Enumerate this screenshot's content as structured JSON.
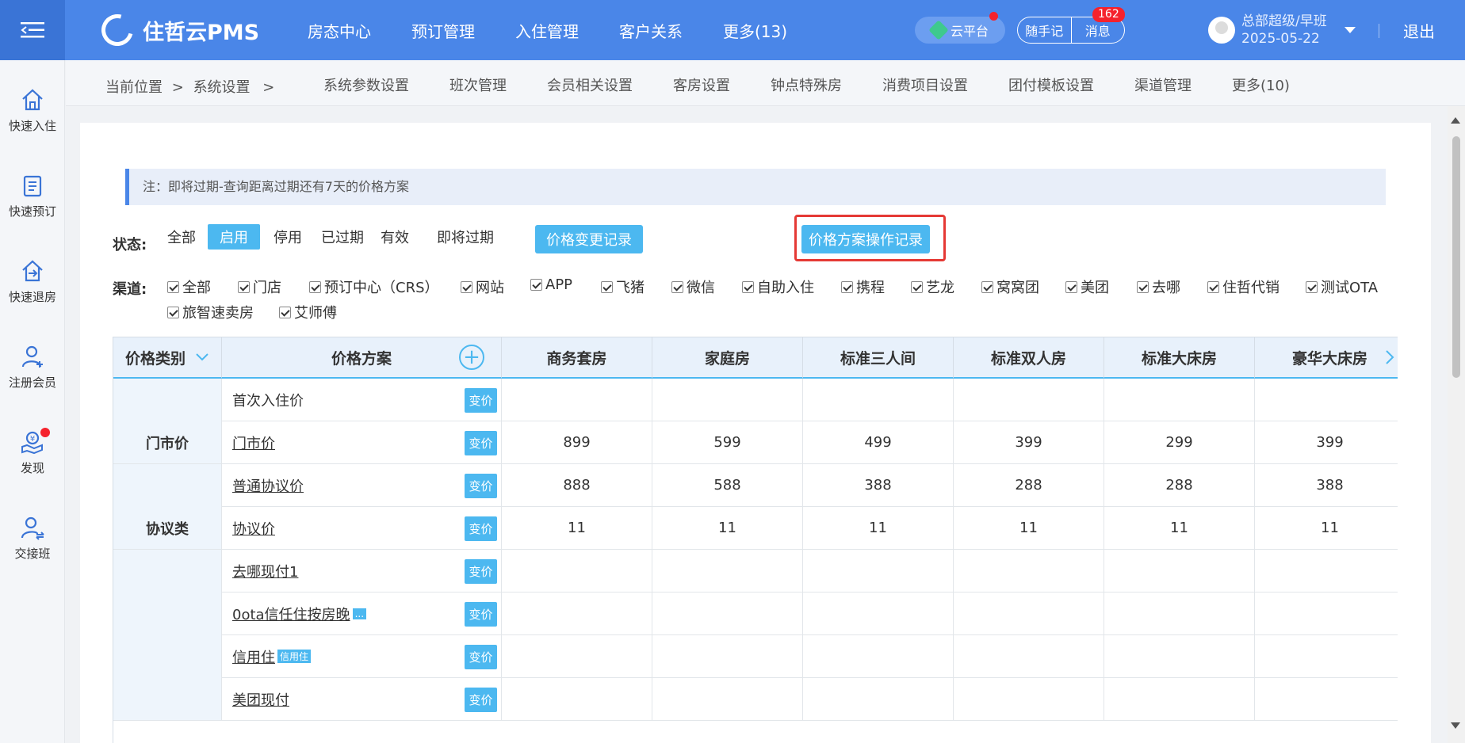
{
  "app": {
    "title": "住哲云PMS"
  },
  "topnav": {
    "items": [
      "房态中心",
      "预订管理",
      "入住管理",
      "客户关系",
      "更多(13)"
    ]
  },
  "header": {
    "cloud_label": "云平台",
    "note_label": "随手记",
    "message_label": "消息",
    "message_count": "162",
    "user_name": "总部超级/早班",
    "user_date": "2025-05-22",
    "logout_label": "退出"
  },
  "sidebar": {
    "items": [
      {
        "label": "快速入住",
        "icon": "home-icon"
      },
      {
        "label": "快速预订",
        "icon": "book-icon"
      },
      {
        "label": "快速退房",
        "icon": "checkout-icon"
      },
      {
        "label": "注册会员",
        "icon": "add-user-icon"
      },
      {
        "label": "发现",
        "icon": "discover-icon"
      },
      {
        "label": "交接班",
        "icon": "handover-icon"
      }
    ]
  },
  "breadcrumb": {
    "current": "当前位置",
    "section": "系统设置",
    "sep": ">"
  },
  "subnav": {
    "items": [
      "系统参数设置",
      "班次管理",
      "会员相关设置",
      "客房设置",
      "钟点特殊房",
      "消费项目设置",
      "团付模板设置",
      "渠道管理",
      "更多(10)"
    ]
  },
  "notice": "注：即将过期-查询距离过期还有7天的价格方案",
  "status_filter": {
    "label": "状态:",
    "options": [
      "全部",
      "启用",
      "停用",
      "已过期",
      "有效",
      "即将过期"
    ],
    "active": "启用",
    "price_change_log": "价格变更记录",
    "plan_operation_log": "价格方案操作记录"
  },
  "channel_filter": {
    "label": "渠道:",
    "options": [
      "全部",
      "门店",
      "预订中心（CRS）",
      "网站",
      "APP",
      "飞猪",
      "微信",
      "自助入住",
      "携程",
      "艺龙",
      "窝窝团",
      "美团",
      "去哪",
      "住哲代销",
      "测试OTA",
      "旅智速卖房",
      "艾师傅"
    ]
  },
  "table": {
    "headers": {
      "category": "价格类别",
      "plan": "价格方案",
      "rooms": [
        "商务套房",
        "家庭房",
        "标准三人间",
        "标准双人房",
        "标准大床房",
        "豪华大床房"
      ]
    },
    "change_label": "变价",
    "categories": [
      "门市价",
      "协议类"
    ],
    "rows": [
      {
        "plan": "首次入住价",
        "underline": false,
        "tag": "",
        "prices": [
          "",
          "",
          "",
          "",
          "",
          ""
        ]
      },
      {
        "plan": "门市价",
        "underline": true,
        "tag": "",
        "prices": [
          "899",
          "599",
          "499",
          "399",
          "299",
          "399"
        ]
      },
      {
        "plan": "普通协议价",
        "underline": true,
        "tag": "",
        "prices": [
          "888",
          "588",
          "388",
          "288",
          "288",
          "388"
        ]
      },
      {
        "plan": "协议价",
        "underline": true,
        "tag": "",
        "prices": [
          "11",
          "11",
          "11",
          "11",
          "11",
          "11"
        ]
      },
      {
        "plan": "去哪现付1",
        "underline": true,
        "tag": "",
        "prices": [
          "",
          "",
          "",
          "",
          "",
          ""
        ]
      },
      {
        "plan": "0ota信任住按房晚",
        "underline": true,
        "tag": "...",
        "prices": [
          "",
          "",
          "",
          "",
          "",
          ""
        ]
      },
      {
        "plan": "信用住",
        "underline": true,
        "tag": "信用住",
        "prices": [
          "",
          "",
          "",
          "",
          "",
          ""
        ]
      },
      {
        "plan": "美团现付",
        "underline": true,
        "tag": "",
        "prices": [
          "",
          "",
          "",
          "",
          "",
          ""
        ]
      }
    ]
  }
}
